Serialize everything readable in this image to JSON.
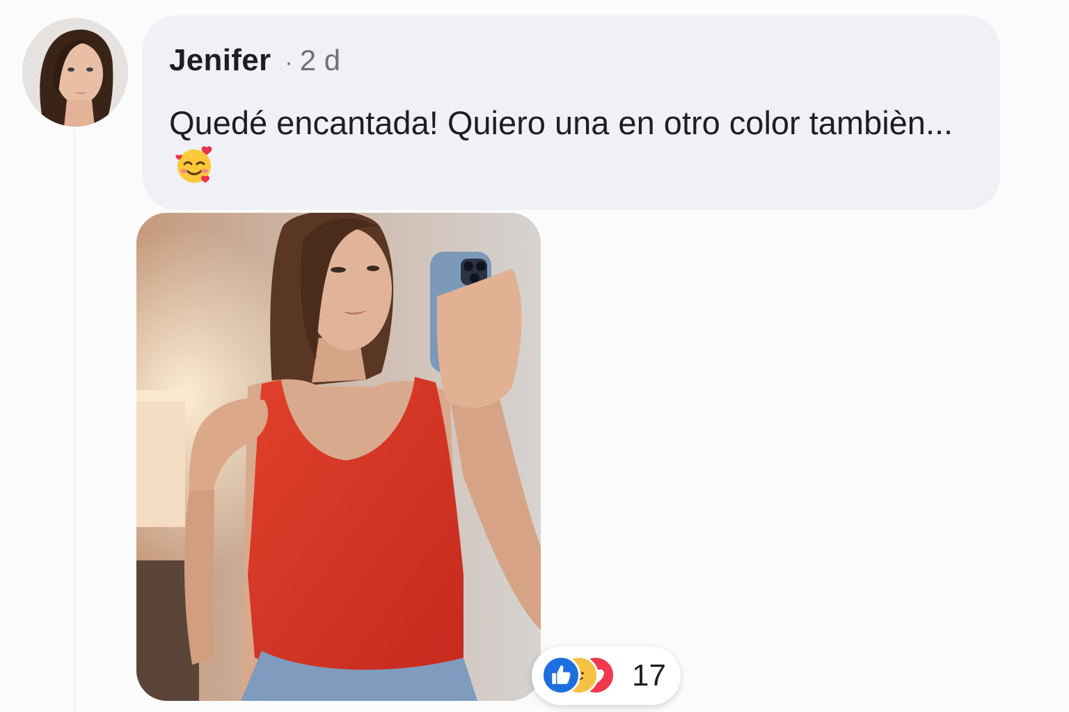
{
  "comment": {
    "author": "Jenifer",
    "separator": "·",
    "timestamp": "2 d",
    "text": "Quedé encantada! Quiero una en otro color tambièn...",
    "emoji": "smiling-face-with-hearts"
  },
  "reactions": {
    "types": [
      "like",
      "care",
      "love"
    ],
    "count": "17"
  },
  "colors": {
    "bubble": "#f0f1f6",
    "like": "#1d6fe0",
    "love": "#f0384f",
    "care": "#f6c244"
  }
}
